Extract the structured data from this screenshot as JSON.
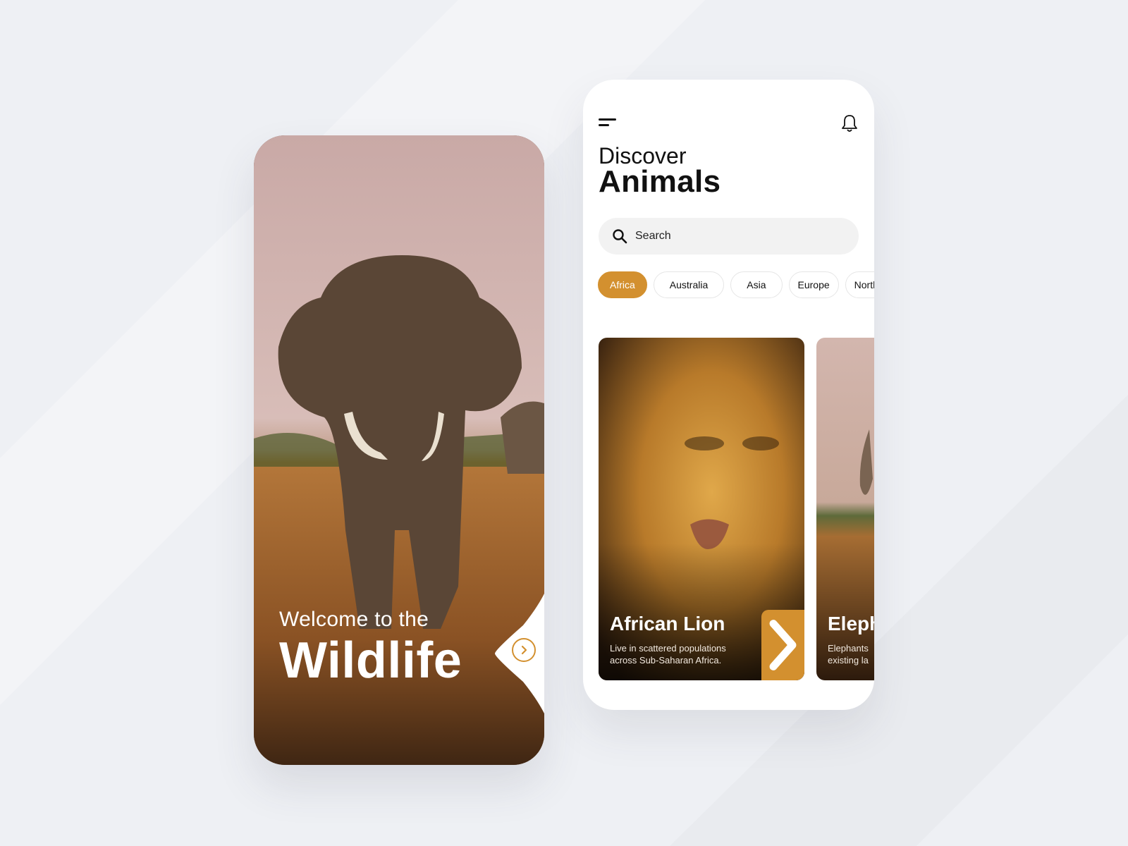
{
  "colors": {
    "accent": "#d3902f",
    "background": "#eef0f4",
    "text": "#111111"
  },
  "onboarding": {
    "welcome_line": "Welcome to the",
    "title": "Wildlife",
    "next_icon": "chevron-right-icon"
  },
  "discover": {
    "menu_icon": "menu-icon",
    "bell_icon": "bell-icon",
    "heading_light": "Discover",
    "heading_bold": "Animals",
    "search": {
      "icon": "search-icon",
      "placeholder": "Search",
      "value": ""
    },
    "regions": [
      {
        "label": "Africa",
        "selected": true
      },
      {
        "label": "Australia",
        "selected": false
      },
      {
        "label": "Asia",
        "selected": false
      },
      {
        "label": "Europe",
        "selected": false
      },
      {
        "label": "North",
        "selected": false
      }
    ],
    "cards": [
      {
        "title": "African Lion",
        "description_line1": "Live in scattered populations",
        "description_line2": "across Sub-Saharan Africa.",
        "action_icon": "chevron-right-icon"
      },
      {
        "title": "Elephant",
        "description_line1": "Elephants",
        "description_line2": "existing la"
      }
    ]
  }
}
